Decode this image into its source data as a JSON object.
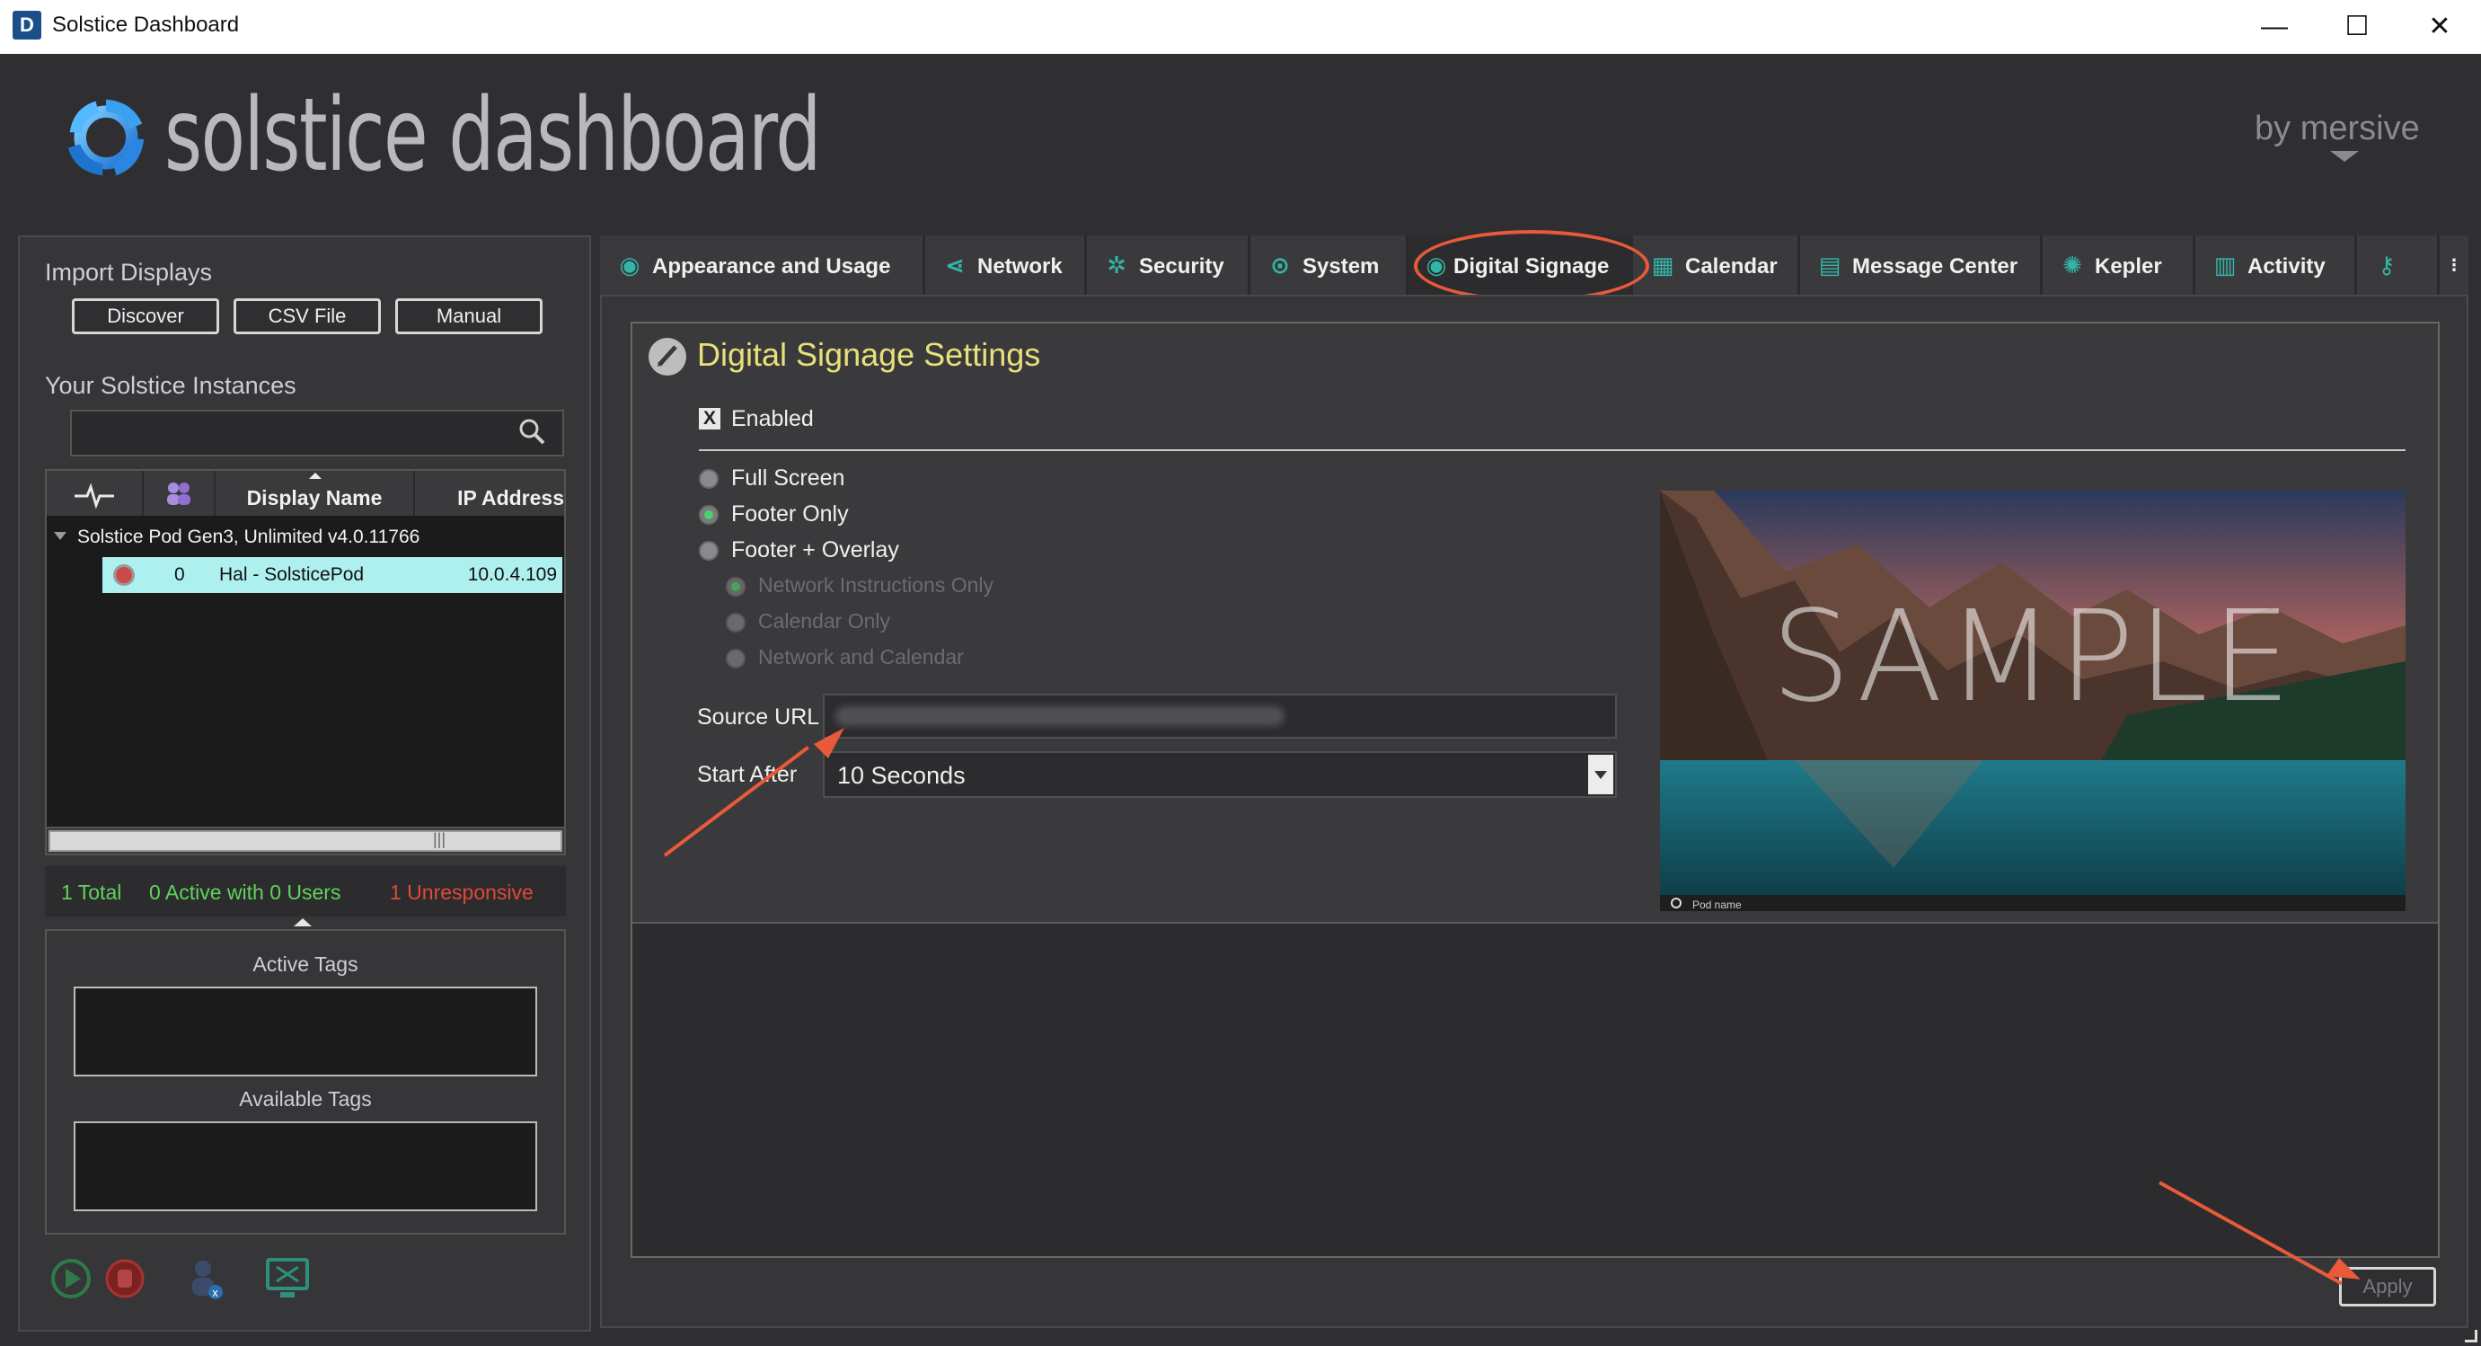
{
  "window": {
    "title": "Solstice Dashboard",
    "app_icon_letter": "D",
    "controls": {
      "minimize": "—",
      "maximize": "☐",
      "close": "✕"
    }
  },
  "header": {
    "brand": "solstice dashboard",
    "byline": "by mersive"
  },
  "left_panel": {
    "import_label": "Import Displays",
    "buttons": {
      "discover": "Discover",
      "csv": "CSV File",
      "manual": "Manual"
    },
    "instances_label": "Your Solstice Instances",
    "search_value": "",
    "grid": {
      "columns": [
        "",
        "",
        "Display Name",
        "IP Address"
      ],
      "group": "Solstice Pod Gen3, Unlimited v4.0.11766",
      "rows": [
        {
          "users": "0",
          "display_name": "Hal - SolsticePod",
          "ip": "10.0.4.109"
        }
      ],
      "scroll_grip": "|||"
    },
    "status": {
      "total": "1 Total",
      "active": "0 Active with 0 Users",
      "unresponsive": "1 Unresponsive"
    },
    "tags": {
      "active_label": "Active Tags",
      "available_label": "Available Tags"
    }
  },
  "tabs": [
    {
      "label": "Appearance and Usage",
      "icon": "eye-icon"
    },
    {
      "label": "Network",
      "icon": "network-icon"
    },
    {
      "label": "Security",
      "icon": "gear-icon"
    },
    {
      "label": "System",
      "icon": "system-icon"
    },
    {
      "label": "Digital Signage",
      "icon": "eye-icon",
      "active": true
    },
    {
      "label": "Calendar",
      "icon": "calendar-icon"
    },
    {
      "label": "Message Center",
      "icon": "message-icon"
    },
    {
      "label": "Kepler",
      "icon": "kepler-icon"
    },
    {
      "label": "Activity",
      "icon": "bar-chart-icon"
    }
  ],
  "signage": {
    "title": "Digital Signage Settings",
    "enabled_label": "Enabled",
    "enabled_mark": "X",
    "modes": [
      {
        "label": "Full Screen",
        "selected": false
      },
      {
        "label": "Footer Only",
        "selected": true
      },
      {
        "label": "Footer + Overlay",
        "selected": false
      }
    ],
    "overlay_options": [
      {
        "label": "Network Instructions Only",
        "selected": true
      },
      {
        "label": "Calendar Only",
        "selected": false
      },
      {
        "label": "Network and Calendar",
        "selected": false
      }
    ],
    "source_url_label": "Source URL",
    "source_url_value": "",
    "start_after_label": "Start After",
    "start_after_value": "10 Seconds",
    "preview_watermark": "SAMPLE",
    "preview_footer": "Pod name",
    "apply_label": "Apply"
  },
  "colors": {
    "accent_teal": "#33b6a8",
    "title_yellow": "#e8e07a",
    "status_green": "#5fd35a",
    "status_red": "#e0483a",
    "annotation": "#e85a3a",
    "selected_row": "#aef0f0"
  }
}
